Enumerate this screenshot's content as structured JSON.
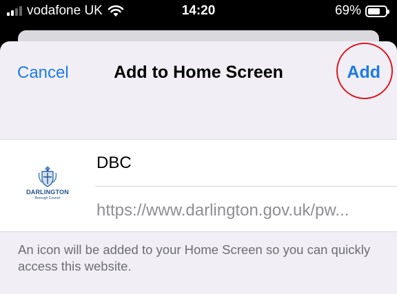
{
  "status_bar": {
    "carrier": "vodafone UK",
    "time": "14:20",
    "battery_percent": "69%",
    "battery_level": 0.69
  },
  "nav": {
    "cancel_label": "Cancel",
    "title": "Add to Home Screen",
    "add_label": "Add",
    "annotation_color": "#e0141b"
  },
  "site": {
    "logo_name": "DARLINGTON",
    "logo_subtitle": "Borough Council",
    "name_value": "DBC",
    "url": "https://www.darlington.gov.uk/pw..."
  },
  "footnote": "An icon will be added to your Home Screen so you can quickly access this website.",
  "colors": {
    "accent": "#1e7ae8",
    "sheet_background": "#f1eff5"
  }
}
